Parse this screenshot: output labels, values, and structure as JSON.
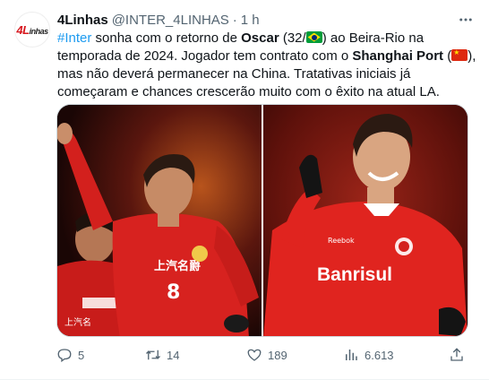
{
  "tweet": {
    "author_name": "4Linhas",
    "handle": "@INTER_4LINHAS",
    "separator": "·",
    "time": "1 h",
    "avatar_text": "4L",
    "avatar_suffix": "inhas",
    "more_label": "···",
    "text": {
      "hashtag": "#Inter",
      "p1": " sonha com o retorno de ",
      "oscar": "Oscar",
      "p2": " (32/",
      "p3": ") ao Beira-Rio na temporada de 2024. Jogador tem contrato com o ",
      "club": "Shanghai Port",
      "p4": " (",
      "p5": "), mas não deverá permanecer na China. Tratativas iniciais já começaram e chances crescerão muito com o êxito na atual LA."
    },
    "media": {
      "left_shirt_sponsor": "上汽名爵",
      "left_shirt_number": "8",
      "left_secondary_sponsor": "上汽名",
      "right_shirt_sponsor": "Banrisul",
      "right_shirt_brand": "Reebok"
    },
    "stats": {
      "replies": "5",
      "retweets": "14",
      "likes": "189",
      "views": "6.613"
    }
  },
  "colors": {
    "accent": "#1d9bf0",
    "muted": "#536471",
    "text": "#0f1419",
    "brand_red": "#d71920"
  },
  "icons": {
    "reply": "reply-icon",
    "retweet": "retweet-icon",
    "like": "heart-icon",
    "views": "views-icon",
    "share": "share-icon",
    "more": "more-icon"
  }
}
